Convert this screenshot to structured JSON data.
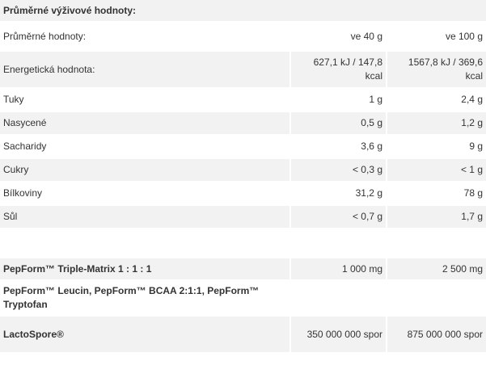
{
  "header": {
    "title": "Průměrné výživové hodnoty:"
  },
  "columns": {
    "label": "Průměrné hodnoty:",
    "per_serving": "ve 40 g",
    "per_100": "ve 100 g"
  },
  "nutrients": [
    {
      "name": "Energetická hodnota:",
      "per_serving": "627,1 kJ / 147,8 kcal",
      "per_100": "1567,8 kJ / 369,6 kcal"
    },
    {
      "name": "Tuky",
      "per_serving": "1 g",
      "per_100": "2,4 g"
    },
    {
      "name": "Nasycené",
      "per_serving": "0,5 g",
      "per_100": "1,2 g"
    },
    {
      "name": "Sacharidy",
      "per_serving": "3,6 g",
      "per_100": "9 g"
    },
    {
      "name": "Cukry",
      "per_serving": "< 0,3 g",
      "per_100": "< 1 g"
    },
    {
      "name": "Bílkoviny",
      "per_serving": "31,2 g",
      "per_100": "78 g"
    },
    {
      "name": "Sůl",
      "per_serving": "< 0,7 g",
      "per_100": "1,7 g"
    }
  ],
  "ingredients": [
    {
      "name": "PepForm™  Triple-Matrix 1 : 1 : 1",
      "per_serving": "1 000 mg",
      "per_100": "2 500 mg"
    },
    {
      "name": "PepForm™ Leucin, PepForm™ BCAA 2:1:1, PepForm™ Tryptofan",
      "per_serving": "",
      "per_100": ""
    },
    {
      "name": "LactoSpore®",
      "per_serving": "350 000 000 spor",
      "per_100": "875 000 000 spor"
    }
  ]
}
